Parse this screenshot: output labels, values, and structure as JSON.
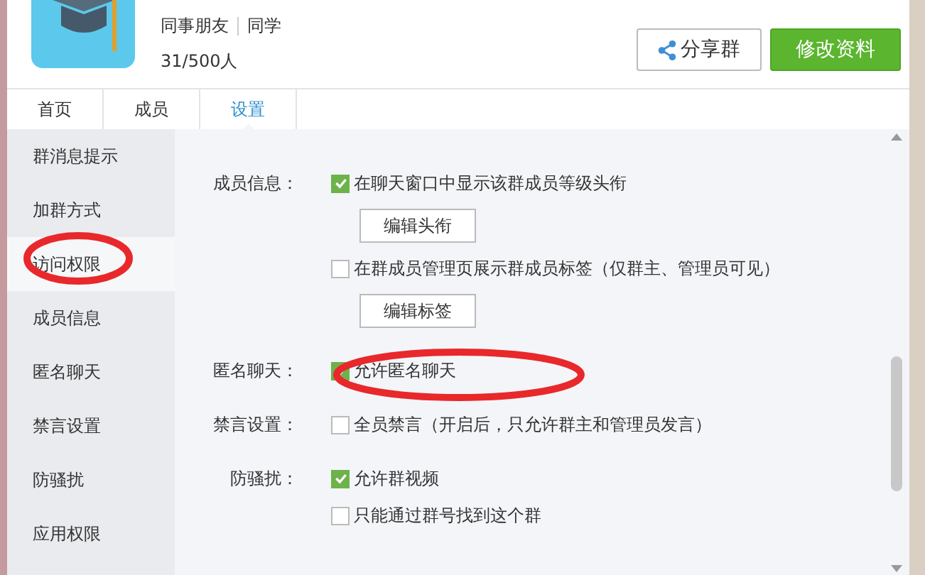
{
  "header": {
    "group_tags": [
      "同事朋友",
      "同学"
    ],
    "member_count": "31/500人",
    "share_button": "分享群",
    "edit_button": "修改资料"
  },
  "tabs": [
    {
      "label": "首页",
      "selected": false
    },
    {
      "label": "成员",
      "selected": false
    },
    {
      "label": "设置",
      "selected": true
    }
  ],
  "sidebar": {
    "items": [
      {
        "label": "群消息提示",
        "selected": false
      },
      {
        "label": "加群方式",
        "selected": false
      },
      {
        "label": "访问权限",
        "selected": true
      },
      {
        "label": "成员信息",
        "selected": false
      },
      {
        "label": "匿名聊天",
        "selected": false
      },
      {
        "label": "禁言设置",
        "selected": false
      },
      {
        "label": "防骚扰",
        "selected": false
      },
      {
        "label": "应用权限",
        "selected": false
      }
    ]
  },
  "settings": [
    {
      "label": "成员信息：",
      "options": [
        {
          "kind": "checkbox",
          "text": "在聊天窗口中显示该群成员等级头衔",
          "checked": true
        },
        {
          "kind": "button",
          "text": "编辑头衔"
        },
        {
          "kind": "checkbox",
          "text": "在群成员管理页展示群成员标签（仅群主、管理员可见）",
          "checked": false
        },
        {
          "kind": "button",
          "text": "编辑标签"
        }
      ]
    },
    {
      "label": "匿名聊天：",
      "options": [
        {
          "kind": "checkbox",
          "text": "允许匿名聊天",
          "checked": true
        }
      ]
    },
    {
      "label": "禁言设置：",
      "options": [
        {
          "kind": "checkbox",
          "text": "全员禁言（开启后，只允许群主和管理员发言）",
          "checked": false
        }
      ]
    },
    {
      "label": "防骚扰：",
      "options": [
        {
          "kind": "checkbox",
          "text": "允许群视频",
          "checked": true
        },
        {
          "kind": "checkbox",
          "text": "只能通过群号找到这个群",
          "checked": false
        }
      ]
    }
  ]
}
